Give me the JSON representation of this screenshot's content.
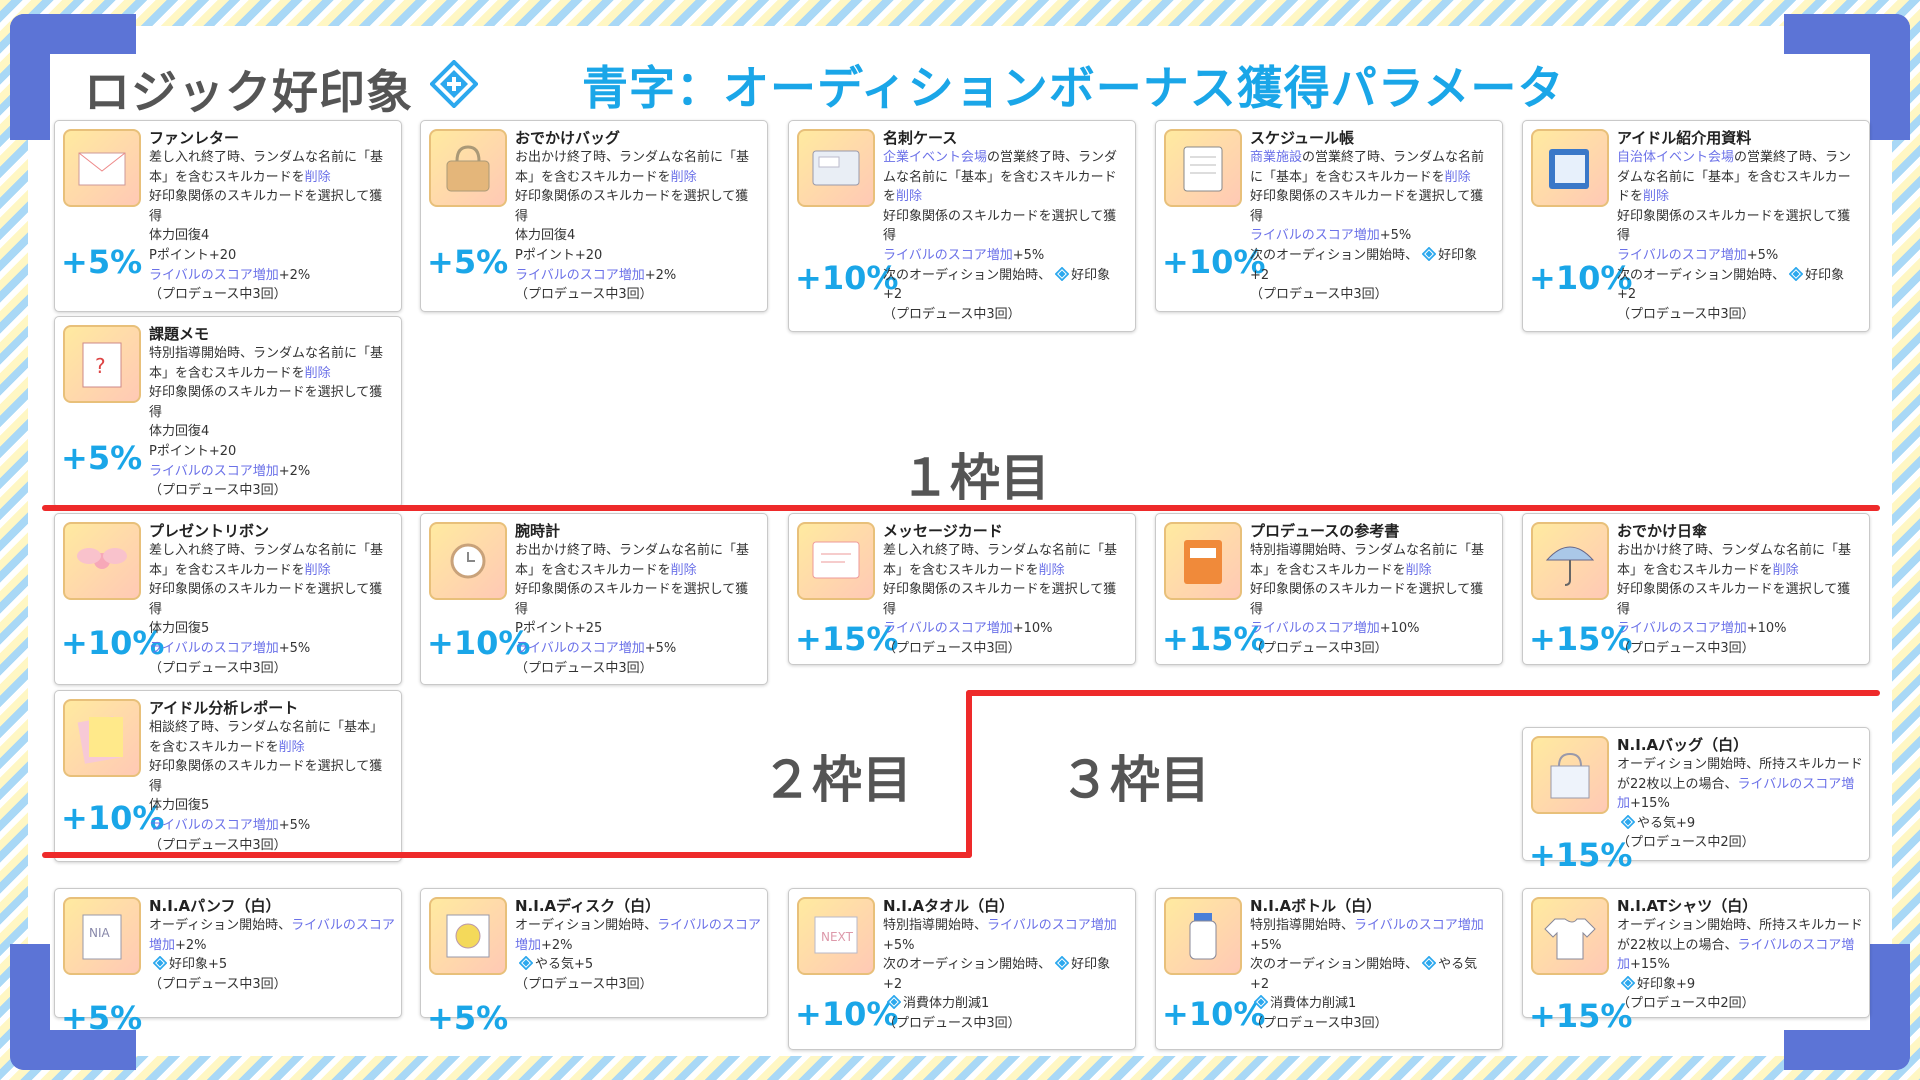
{
  "header": {
    "title": "ロジック好印象",
    "subtitle": "青字：オーディションボーナス獲得パラメータ"
  },
  "colors": {
    "accent": "#1aa6e8",
    "skill_blue": "#6b71e8",
    "frame": "#5c74d6",
    "divider": "#ee2a2a"
  },
  "sections": {
    "slot1": "１枠目",
    "slot2": "２枠目",
    "slot3": "３枠目"
  },
  "cards": [
    {
      "name": "ファンレター",
      "pct": "+5%",
      "icon": "letter-icon",
      "lines": [
        [
          {
            "t": "差し入れ終了時、ランダムな名前に「基本」を含むスキルカードを"
          },
          {
            "t": "削除",
            "b": 1
          }
        ],
        [
          {
            "t": "好印象関係のスキルカードを選択して獲得"
          }
        ],
        [
          {
            "t": "体力回復4"
          }
        ],
        [
          {
            "t": "Pポイント+20"
          }
        ],
        [
          {
            "t": "ライバルのスコア増加",
            "b": 1
          },
          {
            "t": "+2%"
          }
        ],
        [
          {
            "t": "（プロデュース中3回）"
          }
        ]
      ]
    },
    {
      "name": "おでかけバッグ",
      "pct": "+5%",
      "icon": "bag-icon",
      "lines": [
        [
          {
            "t": "お出かけ終了時、ランダムな名前に「基本」を含むスキルカードを"
          },
          {
            "t": "削除",
            "b": 1
          }
        ],
        [
          {
            "t": "好印象関係のスキルカードを選択して獲得"
          }
        ],
        [
          {
            "t": "体力回復4"
          }
        ],
        [
          {
            "t": "Pポイント+20"
          }
        ],
        [
          {
            "t": "ライバルのスコア増加",
            "b": 1
          },
          {
            "t": "+2%"
          }
        ],
        [
          {
            "t": "（プロデュース中3回）"
          }
        ]
      ]
    },
    {
      "name": "名刺ケース",
      "pct": "+10%",
      "icon": "card-case-icon",
      "lines": [
        [
          {
            "t": "企業イベント会場",
            "b": 1
          },
          {
            "t": "の営業終了時、ランダムな名前に「基本」を含むスキルカードを"
          },
          {
            "t": "削除",
            "b": 1
          }
        ],
        [
          {
            "t": "好印象関係のスキルカードを選択して獲得"
          }
        ],
        [
          {
            "t": "ライバルのスコア増加",
            "b": 1
          },
          {
            "t": "+5%"
          }
        ],
        [
          {
            "t": "次のオーディション開始時、"
          },
          {
            "i": 1
          },
          {
            "t": "好印象+2"
          }
        ],
        [
          {
            "t": "（プロデュース中3回）"
          }
        ]
      ]
    },
    {
      "name": "スケジュール帳",
      "pct": "+10%",
      "icon": "planner-icon",
      "lines": [
        [
          {
            "t": "商業施設",
            "b": 1
          },
          {
            "t": "の営業終了時、ランダムな名前に「基本」を含むスキルカードを"
          },
          {
            "t": "削除",
            "b": 1
          }
        ],
        [
          {
            "t": "好印象関係のスキルカードを選択して獲得"
          }
        ],
        [
          {
            "t": "ライバルのスコア増加",
            "b": 1
          },
          {
            "t": "+5%"
          }
        ],
        [
          {
            "t": "次のオーディション開始時、"
          },
          {
            "i": 1
          },
          {
            "t": "好印象+2"
          }
        ],
        [
          {
            "t": "（プロデュース中3回）"
          }
        ]
      ]
    },
    {
      "name": "アイドル紹介用資料",
      "pct": "+10%",
      "icon": "folder-icon",
      "lines": [
        [
          {
            "t": "自治体イベント会場",
            "b": 1
          },
          {
            "t": "の営業終了時、ランダムな名前に「基本」を含むスキルカードを"
          },
          {
            "t": "削除",
            "b": 1
          }
        ],
        [
          {
            "t": "好印象関係のスキルカードを選択して獲得"
          }
        ],
        [
          {
            "t": "ライバルのスコア増加",
            "b": 1
          },
          {
            "t": "+5%"
          }
        ],
        [
          {
            "t": "次のオーディション開始時、"
          },
          {
            "i": 1
          },
          {
            "t": "好印象+2"
          }
        ],
        [
          {
            "t": "（プロデュース中3回）"
          }
        ]
      ]
    },
    {
      "name": "課題メモ",
      "pct": "+5%",
      "icon": "memo-icon",
      "lines": [
        [
          {
            "t": "特別指導開始時、ランダムな名前に「基本」を含むスキルカードを"
          },
          {
            "t": "削除",
            "b": 1
          }
        ],
        [
          {
            "t": "好印象関係のスキルカードを選択して獲得"
          }
        ],
        [
          {
            "t": "体力回復4"
          }
        ],
        [
          {
            "t": "Pポイント+20"
          }
        ],
        [
          {
            "t": "ライバルのスコア増加",
            "b": 1
          },
          {
            "t": "+2%"
          }
        ],
        [
          {
            "t": "（プロデュース中3回）"
          }
        ]
      ]
    },
    {
      "name": "プレゼントリボン",
      "pct": "+10%",
      "icon": "ribbon-icon",
      "lines": [
        [
          {
            "t": "差し入れ終了時、ランダムな名前に「基本」を含むスキルカードを"
          },
          {
            "t": "削除",
            "b": 1
          }
        ],
        [
          {
            "t": "好印象関係のスキルカードを選択して獲得"
          }
        ],
        [
          {
            "t": "体力回復5"
          }
        ],
        [
          {
            "t": "ライバルのスコア増加",
            "b": 1
          },
          {
            "t": "+5%"
          }
        ],
        [
          {
            "t": "（プロデュース中3回）"
          }
        ]
      ]
    },
    {
      "name": "腕時計",
      "pct": "+10%",
      "icon": "watch-icon",
      "lines": [
        [
          {
            "t": "お出かけ終了時、ランダムな名前に「基本」を含むスキルカードを"
          },
          {
            "t": "削除",
            "b": 1
          }
        ],
        [
          {
            "t": "好印象関係のスキルカードを選択して獲得"
          }
        ],
        [
          {
            "t": "Pポイント+25"
          }
        ],
        [
          {
            "t": "ライバルのスコア増加",
            "b": 1
          },
          {
            "t": "+5%"
          }
        ],
        [
          {
            "t": "（プロデュース中3回）"
          }
        ]
      ]
    },
    {
      "name": "メッセージカード",
      "pct": "+15%",
      "icon": "message-card-icon",
      "lines": [
        [
          {
            "t": "差し入れ終了時、ランダムな名前に「基本」を含むスキルカードを"
          },
          {
            "t": "削除",
            "b": 1
          }
        ],
        [
          {
            "t": "好印象関係のスキルカードを選択して獲得"
          }
        ],
        [
          {
            "t": "ライバルのスコア増加",
            "b": 1
          },
          {
            "t": "+10%"
          }
        ],
        [
          {
            "t": "（プロデュース中3回）"
          }
        ]
      ]
    },
    {
      "name": "プロデュースの参考書",
      "pct": "+15%",
      "icon": "book-icon",
      "lines": [
        [
          {
            "t": "特別指導開始時、ランダムな名前に「基本」を含むスキルカードを"
          },
          {
            "t": "削除",
            "b": 1
          }
        ],
        [
          {
            "t": "好印象関係のスキルカードを選択して獲得"
          }
        ],
        [
          {
            "t": "ライバルのスコア増加",
            "b": 1
          },
          {
            "t": "+10%"
          }
        ],
        [
          {
            "t": "（プロデュース中3回）"
          }
        ]
      ]
    },
    {
      "name": "おでかけ日傘",
      "pct": "+15%",
      "icon": "parasol-icon",
      "lines": [
        [
          {
            "t": "お出かけ終了時、ランダムな名前に「基本」を含むスキルカードを"
          },
          {
            "t": "削除",
            "b": 1
          }
        ],
        [
          {
            "t": "好印象関係のスキルカードを選択して獲得"
          }
        ],
        [
          {
            "t": "ライバルのスコア増加",
            "b": 1
          },
          {
            "t": "+10%"
          }
        ],
        [
          {
            "t": "（プロデュース中3回）"
          }
        ]
      ]
    },
    {
      "name": "アイドル分析レポート",
      "pct": "+10%",
      "icon": "report-icon",
      "lines": [
        [
          {
            "t": "相談終了時、ランダムな名前に「基本」を含むスキルカードを"
          },
          {
            "t": "削除",
            "b": 1
          }
        ],
        [
          {
            "t": "好印象関係のスキルカードを選択して獲得"
          }
        ],
        [
          {
            "t": "体力回復5"
          }
        ],
        [
          {
            "t": "ライバルのスコア増加",
            "b": 1
          },
          {
            "t": "+5%"
          }
        ],
        [
          {
            "t": "（プロデュース中3回）"
          }
        ]
      ]
    },
    {
      "name": "N.I.Aバッグ（白）",
      "pct": "+15%",
      "icon": "tote-bag-icon",
      "lines": [
        [
          {
            "t": "オーディション開始時、所持スキルカードが22枚以上の場合、"
          },
          {
            "t": "ライバルのスコア増加",
            "b": 1
          },
          {
            "t": "+15%"
          }
        ],
        [
          {
            "i": 1
          },
          {
            "t": "やる気+9"
          }
        ],
        [
          {
            "t": "（プロデュース中2回）"
          }
        ]
      ]
    },
    {
      "name": "N.I.Aパンフ（白）",
      "pct": "+5%",
      "icon": "pamphlet-icon",
      "lines": [
        [
          {
            "t": "オーディション開始時、"
          },
          {
            "t": "ライバルのスコア増加",
            "b": 1
          },
          {
            "t": "+2%"
          }
        ],
        [
          {
            "i": 1
          },
          {
            "t": "好印象+5"
          }
        ],
        [
          {
            "t": "（プロデュース中3回）"
          }
        ]
      ]
    },
    {
      "name": "N.I.Aディスク（白）",
      "pct": "+5%",
      "icon": "disc-icon",
      "lines": [
        [
          {
            "t": "オーディション開始時、"
          },
          {
            "t": "ライバルのスコア増加",
            "b": 1
          },
          {
            "t": "+2%"
          }
        ],
        [
          {
            "i": 1
          },
          {
            "t": "やる気+5"
          }
        ],
        [
          {
            "t": "（プロデュース中3回）"
          }
        ]
      ]
    },
    {
      "name": "N.I.Aタオル（白）",
      "pct": "+10%",
      "icon": "towel-icon",
      "lines": [
        [
          {
            "t": "特別指導開始時、"
          },
          {
            "t": "ライバルのスコア増加",
            "b": 1
          },
          {
            "t": "+5%"
          }
        ],
        [
          {
            "t": "次のオーディション開始時、"
          },
          {
            "i": 1
          },
          {
            "t": "好印象+2"
          }
        ],
        [
          {
            "i": 1
          },
          {
            "t": "消費体力削減1"
          }
        ],
        [
          {
            "t": "（プロデュース中3回）"
          }
        ]
      ]
    },
    {
      "name": "N.I.Aボトル（白）",
      "pct": "+10%",
      "icon": "bottle-icon",
      "lines": [
        [
          {
            "t": "特別指導開始時、"
          },
          {
            "t": "ライバルのスコア増加",
            "b": 1
          },
          {
            "t": "+5%"
          }
        ],
        [
          {
            "t": "次のオーディション開始時、"
          },
          {
            "i": 1
          },
          {
            "t": "やる気+2"
          }
        ],
        [
          {
            "i": 1
          },
          {
            "t": "消費体力削減1"
          }
        ],
        [
          {
            "t": "（プロデュース中3回）"
          }
        ]
      ]
    },
    {
      "name": "N.I.ATシャツ（白）",
      "pct": "+15%",
      "icon": "tshirt-icon",
      "lines": [
        [
          {
            "t": "オーディション開始時、所持スキルカードが22枚以上の場合、"
          },
          {
            "t": "ライバルのスコア増加",
            "b": 1
          },
          {
            "t": "+15%"
          }
        ],
        [
          {
            "i": 1
          },
          {
            "t": "好印象+9"
          }
        ],
        [
          {
            "t": "（プロデュース中2回）"
          }
        ]
      ]
    }
  ]
}
